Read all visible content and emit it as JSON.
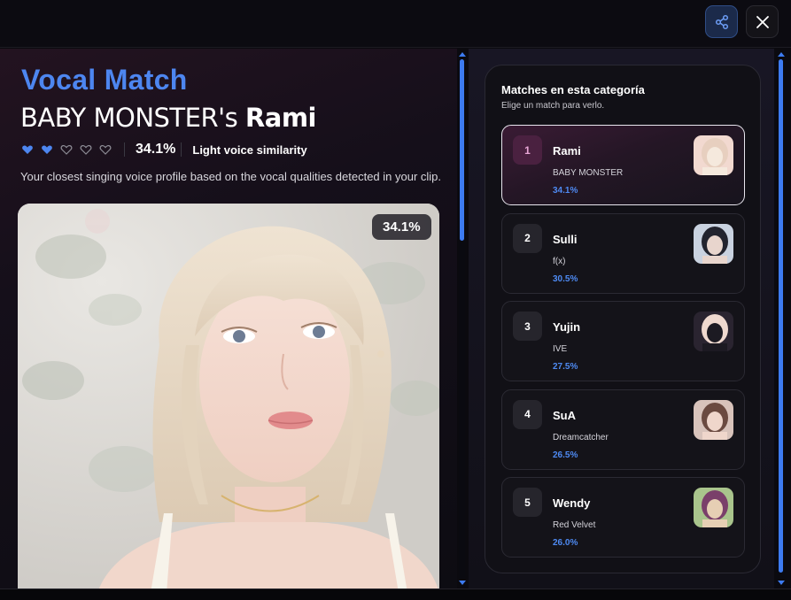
{
  "header": {
    "share_icon": "share-icon",
    "close_icon": "close-icon"
  },
  "result": {
    "title": "Vocal Match",
    "group_prefix": "BABY MONSTER's",
    "name": "Rami",
    "hearts_filled": 2,
    "hearts_total": 5,
    "percent": "34.1%",
    "similarity_label": "Light voice similarity",
    "description": "Your closest singing voice profile based on the vocal qualities detected in your clip.",
    "photo_badge": "34.1%"
  },
  "matches": {
    "title": "Matches en esta categoría",
    "subtitle": "Elige un match para verlo.",
    "items": [
      {
        "rank": "1",
        "name": "Rami",
        "group": "BABY MONSTER",
        "percent": "34.1%",
        "active": true
      },
      {
        "rank": "2",
        "name": "Sulli",
        "group": "f(x)",
        "percent": "30.5%",
        "active": false
      },
      {
        "rank": "3",
        "name": "Yujin",
        "group": "IVE",
        "percent": "27.5%",
        "active": false
      },
      {
        "rank": "4",
        "name": "SuA",
        "group": "Dreamcatcher",
        "percent": "26.5%",
        "active": false
      },
      {
        "rank": "5",
        "name": "Wendy",
        "group": "Red Velvet",
        "percent": "26.0%",
        "active": false
      }
    ]
  },
  "colors": {
    "accent": "#4d86f0",
    "active_rank": "#4a2140"
  }
}
